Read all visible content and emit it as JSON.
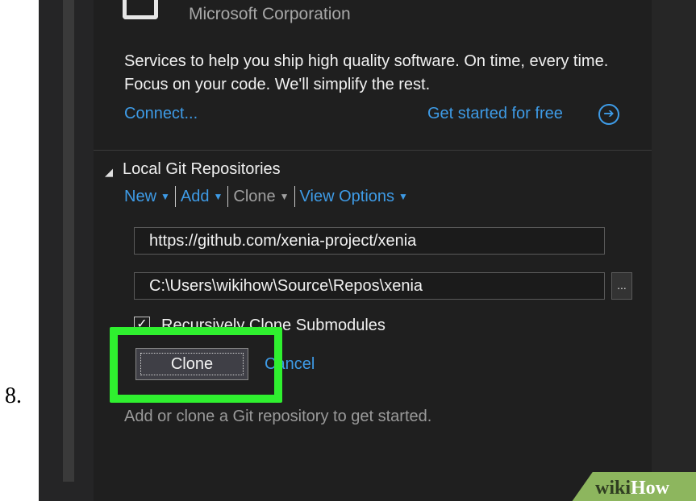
{
  "step_number": "8.",
  "publisher": "Microsoft Corporation",
  "description": "Services to help you ship high quality software. On time, every time. Focus on your code. We'll simplify the rest.",
  "links": {
    "connect": "Connect...",
    "get_started": "Get started for free",
    "get_started_icon": "arrow-right-circle-icon"
  },
  "section": {
    "collapse_glyph": "◢",
    "title": "Local Git Repositories",
    "toolbar": [
      {
        "label": "New",
        "enabled": true
      },
      {
        "label": "Add",
        "enabled": true
      },
      {
        "label": "Clone",
        "enabled": false
      },
      {
        "label": "View Options",
        "enabled": true
      }
    ]
  },
  "clone_form": {
    "url_value": "https://github.com/xenia-project/xenia",
    "path_value": "C:\\Users\\wikihow\\Source\\Repos\\xenia",
    "browse_label": "...",
    "recursive_checked": true,
    "recursive_label": "Recursively Clone Submodules",
    "clone_button": "Clone",
    "cancel_link": "Cancel"
  },
  "hint": "Add or clone a Git repository to get started.",
  "watermark": {
    "wiki": "wiki",
    "how": "How"
  },
  "colors": {
    "link": "#3e9be6",
    "highlight": "#2ff02f",
    "background": "#1f1f1f"
  }
}
